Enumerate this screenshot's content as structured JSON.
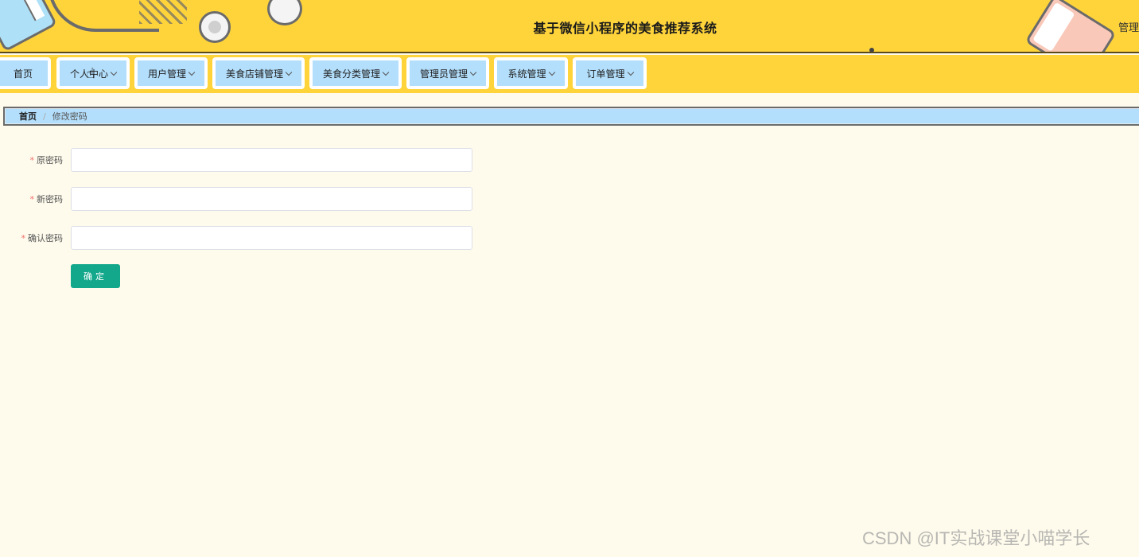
{
  "header": {
    "title": "基于微信小程序的美食推荐系统",
    "admin_label": "管理"
  },
  "nav": {
    "items": [
      {
        "label": "首页",
        "has_dropdown": false
      },
      {
        "label": "个人中心",
        "has_dropdown": true
      },
      {
        "label": "用户管理",
        "has_dropdown": true
      },
      {
        "label": "美食店铺管理",
        "has_dropdown": true
      },
      {
        "label": "美食分类管理",
        "has_dropdown": true
      },
      {
        "label": "管理员管理",
        "has_dropdown": true
      },
      {
        "label": "系统管理",
        "has_dropdown": true
      },
      {
        "label": "订单管理",
        "has_dropdown": true
      }
    ]
  },
  "breadcrumb": {
    "home": "首页",
    "separator": "/",
    "current": "修改密码"
  },
  "form": {
    "required_mark": "*",
    "old_password_label": "原密码",
    "old_password_value": "",
    "new_password_label": "新密码",
    "new_password_value": "",
    "confirm_password_label": "确认密码",
    "confirm_password_value": "",
    "submit_label": "确定"
  },
  "watermark": "CSDN @IT实战课堂小喵学长",
  "colors": {
    "header_bg": "#ffd43b",
    "nav_item_bg": "#b3dffc",
    "page_bg": "#fefbec",
    "primary_button": "#13a88b",
    "required": "#f56c6c"
  }
}
